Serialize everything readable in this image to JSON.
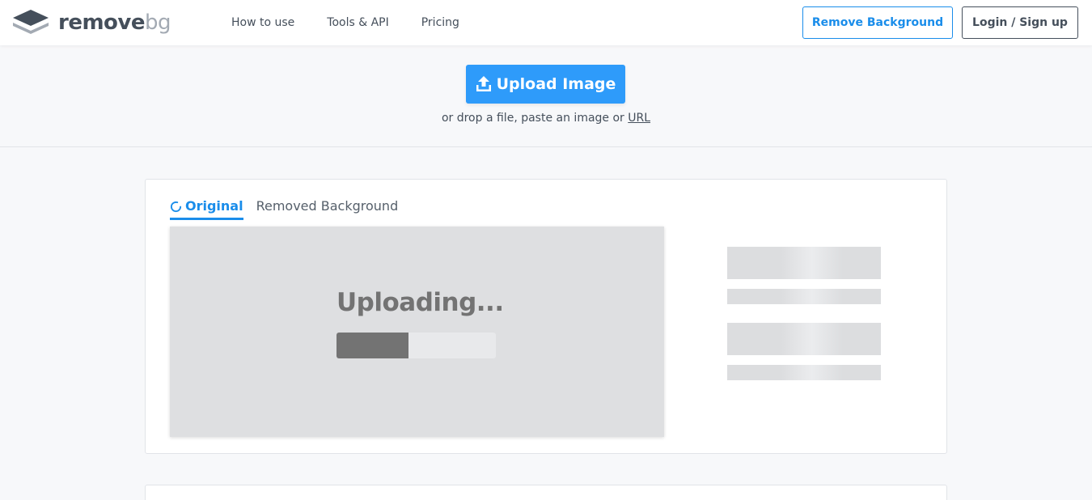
{
  "header": {
    "logo": {
      "word1": "remove",
      "word2": "bg"
    },
    "nav": [
      {
        "label": "How to use"
      },
      {
        "label": "Tools & API"
      },
      {
        "label": "Pricing"
      }
    ],
    "remove_bg_button": "Remove Background",
    "login_button": "Login / Sign up"
  },
  "upload": {
    "button_label": "Upload Image",
    "hint_prefix": "or drop a file, paste an image or",
    "hint_link": "URL"
  },
  "result": {
    "tabs": [
      {
        "label": "Original",
        "active": true
      },
      {
        "label": "Removed Background",
        "active": false
      }
    ],
    "status_text": "Uploading...",
    "progress": 0.45
  },
  "colors": {
    "accent": "#1a8dea",
    "upload_button": "#2e9bfa",
    "text": "#454f5b",
    "preview_bg": "#dedfe1",
    "progress_fill": "#737373"
  },
  "icons": [
    "logo-layers-icon",
    "upload-icon",
    "spinner-icon"
  ]
}
